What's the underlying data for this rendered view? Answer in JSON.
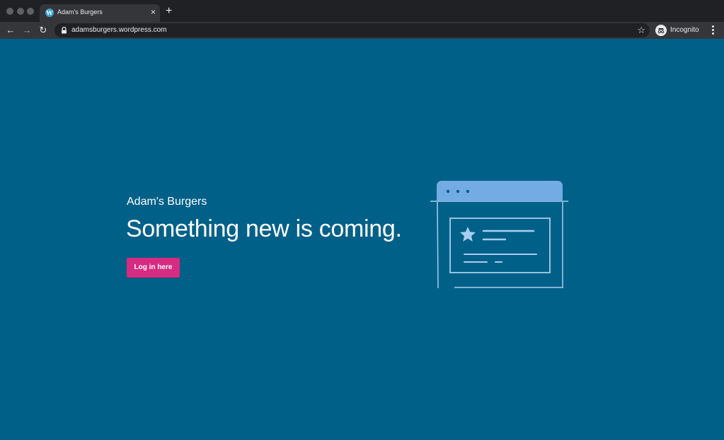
{
  "browser": {
    "tab_title": "Adam's Burgers",
    "tab_close": "×",
    "new_tab": "+",
    "url": "adamsburgers.wordpress.com",
    "profile_label": "Incognito",
    "nav": {
      "back": "←",
      "forward": "→",
      "reload": "↻"
    },
    "bookmark_star": "☆",
    "favicon_letter": "W"
  },
  "page": {
    "site_name": "Adam's Burgers",
    "headline": "Something new is coming.",
    "login_button": "Log in here"
  },
  "colors": {
    "background": "#006088",
    "button": "#d52c82",
    "illustration_accent": "#73ace4",
    "illustration_stroke": "#a8cdf0"
  },
  "icons": [
    "wordpress-favicon-icon",
    "close-icon",
    "plus-icon",
    "back-arrow-icon",
    "forward-arrow-icon",
    "reload-icon",
    "lock-icon",
    "star-outline-icon",
    "incognito-icon",
    "more-vert-icon",
    "browser-window-illustration",
    "star-icon"
  ]
}
